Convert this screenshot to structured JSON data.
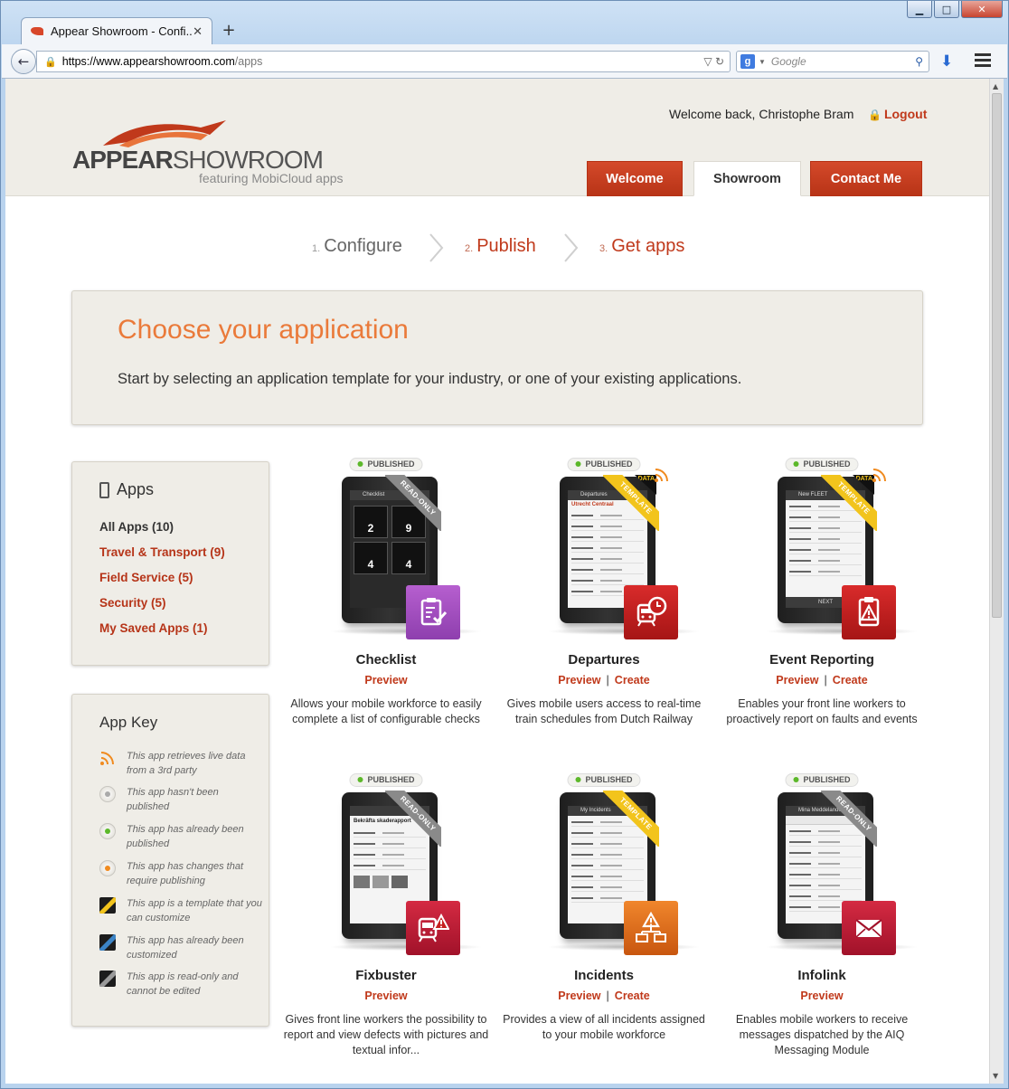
{
  "browser": {
    "tab_title": "Appear Showroom - Confi...",
    "tab_close": "✕",
    "new_tab": "+",
    "url_host": "https://www.appearshowroom.com",
    "url_path": "/apps",
    "search_placeholder": "Google",
    "search_engine_icon": "google-icon"
  },
  "header": {
    "welcome": "Welcome back, Christophe Bram",
    "logout": "Logout",
    "logo_appear": "APPEAR",
    "logo_showroom": "SHOWROOM",
    "logo_tagline": "featuring MobiCloud apps",
    "nav_tabs": [
      {
        "label": "Welcome",
        "active": false
      },
      {
        "label": "Showroom",
        "active": true
      },
      {
        "label": "Contact Me",
        "active": false
      }
    ]
  },
  "steps": [
    {
      "num": "1.",
      "label": "Configure"
    },
    {
      "num": "2.",
      "label": "Publish"
    },
    {
      "num": "3.",
      "label": "Get apps"
    }
  ],
  "hero": {
    "title": "Choose your application",
    "text": "Start by selecting an application template for your industry, or one of your existing applications."
  },
  "sidebar": {
    "apps_title": "Apps",
    "items": [
      "All Apps (10)",
      "Travel & Transport (9)",
      "Field Service (5)",
      "Security (5)",
      "My Saved Apps (1)"
    ]
  },
  "app_key": {
    "title": "App Key",
    "items": [
      {
        "icon": "rss-icon",
        "text": "This app retrieves live data from a 3rd party"
      },
      {
        "icon": "grey-dot-icon",
        "text": "This app hasn't been published"
      },
      {
        "icon": "green-dot-icon",
        "text": "This app has already been published"
      },
      {
        "icon": "orange-dot-icon",
        "text": "This app has changes that require publishing"
      },
      {
        "icon": "yellow-stripe-icon",
        "text": "This app is a template that you can customize"
      },
      {
        "icon": "blue-stripe-icon",
        "text": "This app has already been customized"
      },
      {
        "icon": "grey-stripe-icon",
        "text": "This app is read-only and cannot be edited"
      }
    ]
  },
  "apps": [
    {
      "name": "Checklist",
      "status": "PUBLISHED",
      "ribbon": "READ-ONLY",
      "preview": "Preview",
      "create": "",
      "desc": "Allows your mobile workforce to easily complete a list of configurable checks",
      "screen_title": "Checklist",
      "tiles": [
        "2",
        "9",
        "4",
        "4"
      ]
    },
    {
      "name": "Departures",
      "status": "PUBLISHED",
      "ribbon": "TEMPLATE",
      "data_tag": "DATA",
      "preview": "Preview",
      "create": "Create",
      "desc": "Gives mobile users access to real-time train schedules from Dutch Railway",
      "screen_title": "Departures",
      "screen_sub": "Utrecht Centraal"
    },
    {
      "name": "Event Reporting",
      "status": "PUBLISHED",
      "ribbon": "TEMPLATE",
      "data_tag": "DATA",
      "preview": "Preview",
      "create": "Create",
      "desc": "Enables your front line workers to proactively report on faults and events",
      "screen_title": "New FLEET",
      "screen_button": "NEXT"
    },
    {
      "name": "Fixbuster",
      "status": "PUBLISHED",
      "ribbon": "READ-ONLY",
      "preview": "Preview",
      "create": "",
      "desc": "Gives front line workers the possibility to report and view defects with pictures and textual infor...",
      "screen_title": "Bekräfta skaderapport"
    },
    {
      "name": "Incidents",
      "status": "PUBLISHED",
      "ribbon": "TEMPLATE",
      "preview": "Preview",
      "create": "Create",
      "desc": "Provides a view of all incidents assigned to your mobile workforce",
      "screen_title": "My Incidents"
    },
    {
      "name": "Infolink",
      "status": "PUBLISHED",
      "ribbon": "READ-ONLY",
      "preview": "Preview",
      "create": "",
      "desc": "Enables mobile workers to receive messages dispatched by the AIQ Messaging Module",
      "screen_title": "Mina Meddelanden"
    }
  ],
  "colors": {
    "accent": "#c0391b",
    "orange_title": "#ea7a3a",
    "panel": "#efede7"
  }
}
